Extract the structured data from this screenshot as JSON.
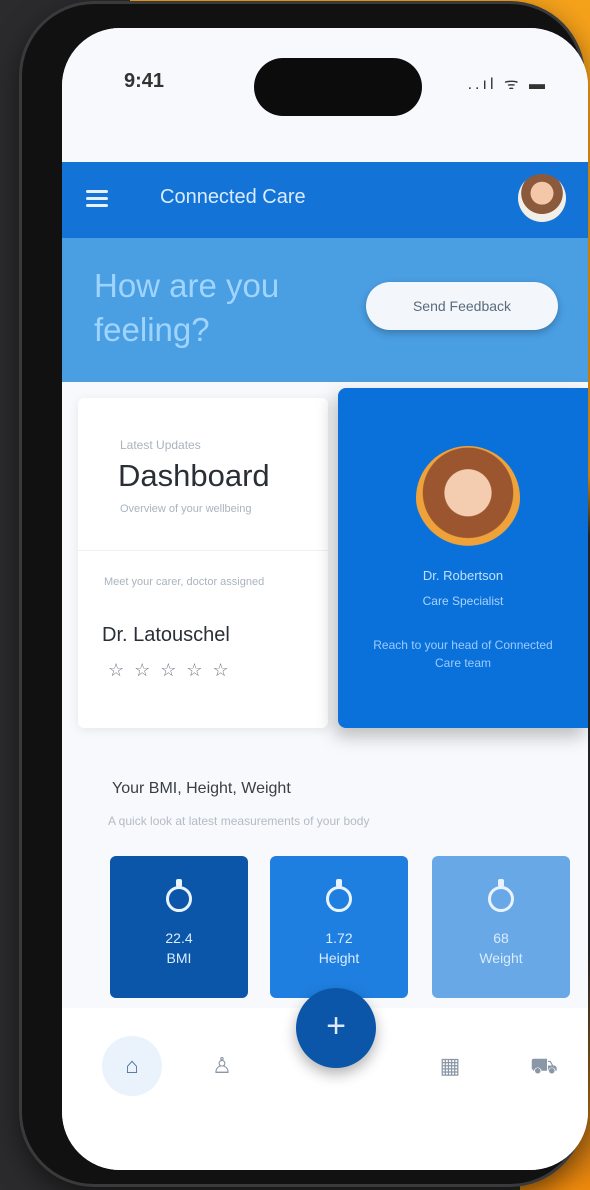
{
  "status_bar": {
    "time": "9:41",
    "icons": "..ıl ᯤ ▬"
  },
  "app_bar": {
    "title": "Connected Care"
  },
  "banner": {
    "title": "How are you feeling?",
    "button_label": "Send Feedback"
  },
  "left_card": {
    "eyebrow": "Latest Updates",
    "title": "Dashboard",
    "subtitle": "Overview of your wellbeing",
    "doctor_caption": "Meet your carer, doctor assigned",
    "doctor_name": "Dr. Latouschel",
    "stars": "☆☆☆☆☆",
    "rating": 0
  },
  "right_card": {
    "name": "Dr. Robertson",
    "role": "Care Specialist",
    "description": "Reach to your head of Connected Care team"
  },
  "section": {
    "title": "Your BMI, Height, Weight",
    "subtitle": "A quick look at latest measurements of your body"
  },
  "metrics": [
    {
      "value": "22.4",
      "label": "BMI"
    },
    {
      "value": "1.72",
      "label": "Height"
    },
    {
      "value": "68",
      "label": "Weight"
    }
  ],
  "fab": {
    "label": "+"
  },
  "tab_bar": {
    "icons": {
      "home": "⌂",
      "person": "♙",
      "calendar": "▦",
      "cart": "⛟"
    }
  },
  "colors": {
    "primary": "#1473d6",
    "banner": "#4a9fe3",
    "card_blue": "#0a71db",
    "dark_tile": "#0b56a8",
    "mid_tile": "#1f7fe0",
    "light_tile": "#68a8e6",
    "accent_orange": "#f5a21b"
  }
}
